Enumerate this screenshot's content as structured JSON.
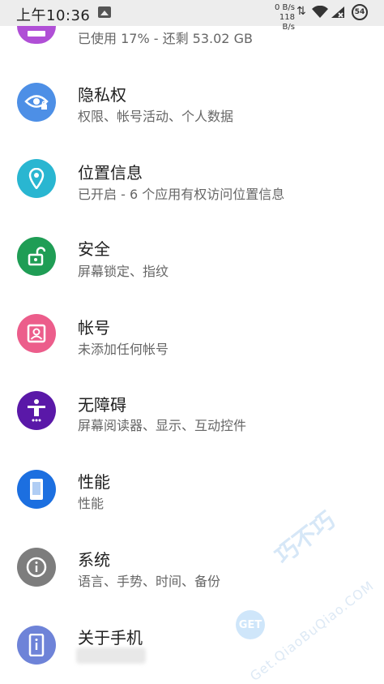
{
  "status_bar": {
    "time": "上午10:36",
    "upload_speed": "0 B/s",
    "download_speed": "118 B/s",
    "battery": "54",
    "icons": [
      "image-icon",
      "data-arrows-icon",
      "wifi-icon",
      "signal-icon",
      "battery-icon"
    ]
  },
  "storage": {
    "subtitle": "已使用 17% - 还剩 53.02 GB",
    "icon_color": "#b04fd6"
  },
  "items": [
    {
      "title": "隐私权",
      "subtitle": "权限、帐号活动、个人数据",
      "icon": "privacy-eye-icon",
      "color": "#4d8fe6"
    },
    {
      "title": "位置信息",
      "subtitle": "已开启 - 6 个应用有权访问位置信息",
      "icon": "location-pin-icon",
      "color": "#29b6d1"
    },
    {
      "title": "安全",
      "subtitle": "屏幕锁定、指纹",
      "icon": "unlock-icon",
      "color": "#1f9d55"
    },
    {
      "title": "帐号",
      "subtitle": "未添加任何帐号",
      "icon": "account-icon",
      "color": "#ec5d8b"
    },
    {
      "title": "无障碍",
      "subtitle": "屏幕阅读器、显示、互动控件",
      "icon": "accessibility-icon",
      "color": "#5a18a8"
    },
    {
      "title": "性能",
      "subtitle": "性能",
      "icon": "phone-performance-icon",
      "color": "#1c6fe0"
    },
    {
      "title": "系统",
      "subtitle": "语言、手势、时间、备份",
      "icon": "info-icon",
      "color": "#7d7d7d"
    },
    {
      "title": "关于手机",
      "subtitle": "",
      "icon": "about-phone-icon",
      "color": "#6e83d8"
    }
  ],
  "watermark": {
    "logo": "GET",
    "brand": "巧不巧",
    "url": "Get.QiaoBuQiao.COM"
  }
}
